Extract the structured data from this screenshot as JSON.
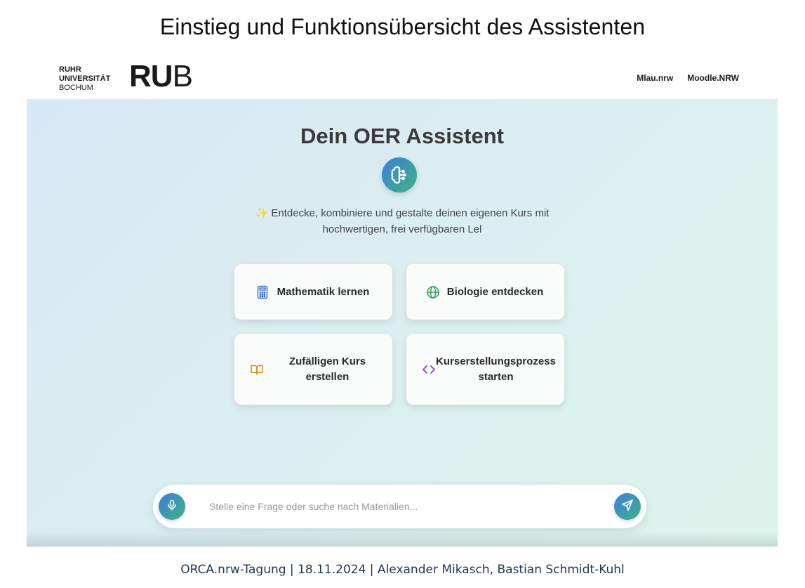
{
  "slide": {
    "title": "Einstieg und Funktionsübersicht des Assistenten",
    "footer": "ORCA.nrw-Tagung | 18.11.2024 | Alexander Mikasch, Bastian Schmidt-Kuhl"
  },
  "header": {
    "logo_line1": "RUHR",
    "logo_line2": "UNIVERSITÄT",
    "logo_line3": "BOCHUM",
    "logo_mark_bold": "RU",
    "logo_mark_light": "B",
    "nav": [
      "Mlau.nrw",
      "Moodle.NRW"
    ]
  },
  "hero": {
    "title": "Dein OER Assistent",
    "icon": "brain-icon",
    "tagline_sparkle": "✨",
    "tagline": "Entdecke, kombiniere und gestalte deinen eigenen Kurs mit hochwertigen, frei verfügbaren Lel"
  },
  "cards": [
    {
      "label": "Mathematik lernen",
      "icon": "calculator-icon",
      "icon_color": "#3b6fd6"
    },
    {
      "label": "Biologie entdecken",
      "icon": "globe-icon",
      "icon_color": "#2f9e55"
    },
    {
      "label": "Zufälligen Kurs erstellen",
      "icon": "book-icon",
      "icon_color": "#d18a1a"
    },
    {
      "label": "Kurserstellungsprozess starten",
      "icon": "code-icon",
      "icon_color": "#8a3fd1"
    }
  ],
  "search": {
    "placeholder": "Stelle eine Frage oder suche nach Materialien...",
    "value": "",
    "mic_icon": "microphone-icon",
    "send_icon": "send-icon"
  },
  "colors": {
    "accent_gradient_start": "#3b7fe0",
    "accent_gradient_end": "#3fb27f"
  }
}
